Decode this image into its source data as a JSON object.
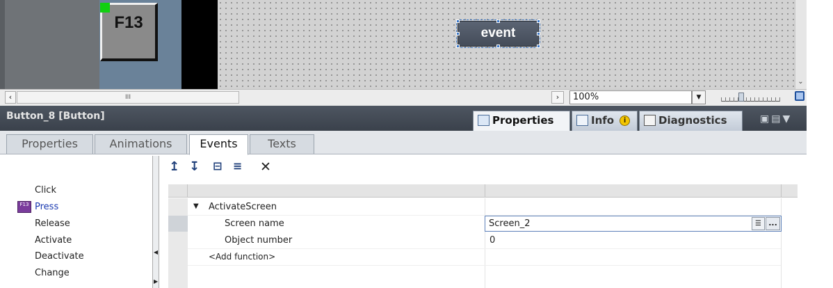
{
  "canvas": {
    "f13_button_label": "F13",
    "event_button_label": "event",
    "zoom_value": "100%",
    "hscroll_grip": "III"
  },
  "inspector": {
    "title": "Button_8 [Button]",
    "top_tabs": [
      "Properties",
      "Info",
      "Diagnostics"
    ],
    "info_warning_glyph": "i",
    "sub_tabs": [
      "Properties",
      "Animations",
      "Events",
      "Texts"
    ],
    "active_sub_tab": "Events"
  },
  "events": {
    "items": [
      "Click",
      "Press",
      "Release",
      "Activate",
      "Deactivate",
      "Change"
    ],
    "selected": "Press",
    "press_icon_text": "F13"
  },
  "function_list": {
    "function_name": "ActivateScreen",
    "params": [
      {
        "name": "Screen name",
        "value": "Screen_2"
      },
      {
        "name": "Object number",
        "value": "0"
      }
    ],
    "add_function": "<Add function>",
    "browse_label": "..."
  },
  "colors": {
    "header_bg": "#3a414b",
    "selected_event": "#1a3ab0",
    "selection_handles": "#3c78c8"
  }
}
